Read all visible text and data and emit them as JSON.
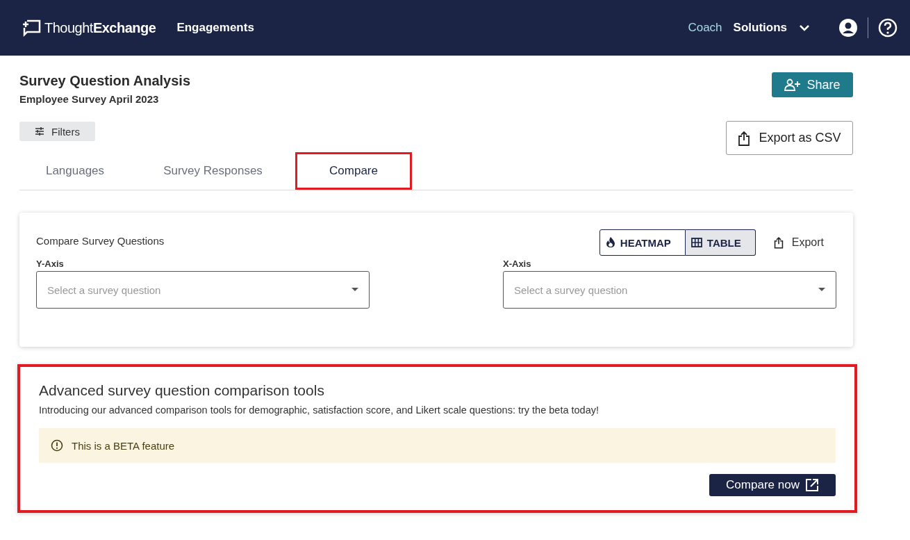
{
  "navbar": {
    "logo_light": "Thought",
    "logo_bold": "Exchange",
    "links": [
      {
        "label": "Engagements",
        "selected": false
      }
    ],
    "right_links": [
      {
        "label": "Coach",
        "selected": true
      },
      {
        "label": "Solutions",
        "selected": false
      }
    ]
  },
  "page": {
    "title": "Survey Question Analysis",
    "subtitle": "Employee Survey April 2023",
    "share_button": "Share",
    "filters_button": "Filters",
    "export_csv_button": "Export as CSV"
  },
  "tabs": [
    {
      "label": "Languages",
      "selected": false,
      "annotated": false
    },
    {
      "label": "Survey Responses",
      "selected": false,
      "annotated": false
    },
    {
      "label": "Compare",
      "selected": true,
      "annotated": true
    }
  ],
  "compare_card": {
    "title": "Compare Survey Questions",
    "views": [
      {
        "label": "HEATMAP",
        "kind": "heatmap",
        "selected": false
      },
      {
        "label": "TABLE",
        "kind": "table",
        "selected": true
      }
    ],
    "export_button": "Export",
    "selects": [
      {
        "label": "Y-Axis",
        "placeholder": "Select a survey question"
      },
      {
        "label": "X-Axis",
        "placeholder": "Select a survey question"
      }
    ]
  },
  "promo": {
    "annotated": true,
    "title": "Advanced survey question comparison tools",
    "text": "Introducing our advanced comparison tools for demographic, satisfaction score, and Likert scale questions: try the beta today!",
    "notice": "This is a BETA feature",
    "button": "Compare now"
  }
}
